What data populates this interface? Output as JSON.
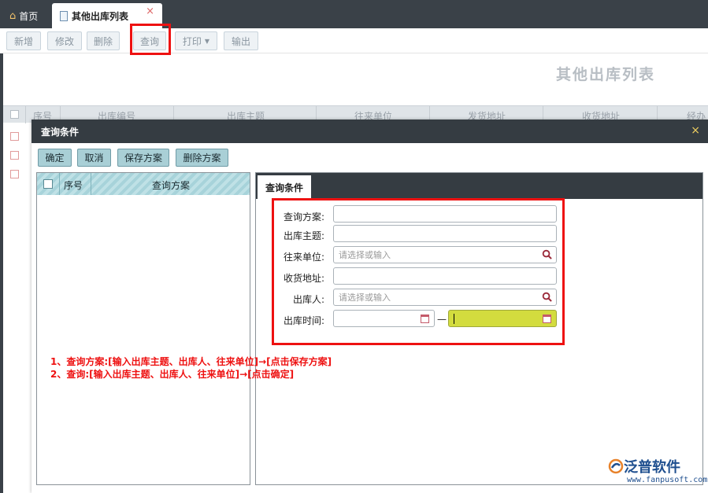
{
  "tabs": {
    "home_label": "首页",
    "active_label": "其他出库列表",
    "close_glyph": "×"
  },
  "toolbar": {
    "add": "新增",
    "edit": "修改",
    "delete": "删除",
    "query": "查询",
    "print": "打印",
    "export": "输出"
  },
  "page_title": "其他出库列表",
  "grid": {
    "columns": [
      "序号",
      "出库编号",
      "出库主题",
      "往来单位",
      "发货地址",
      "收货地址",
      "经办"
    ]
  },
  "modal": {
    "title": "查询条件",
    "close_glyph": "×",
    "buttons": {
      "confirm": "确定",
      "cancel": "取消",
      "save_plan": "保存方案",
      "delete_plan": "删除方案"
    },
    "plan_table": {
      "col_index": "序号",
      "col_plan": "查询方案"
    },
    "condition_tab": "查询条件",
    "form": {
      "plan_label": "查询方案:",
      "subject_label": "出库主题:",
      "partner_label": "往来单位:",
      "partner_placeholder": "请选择或输入",
      "receive_address_label": "收货地址:",
      "outbound_person_label": "出库人:",
      "outbound_person_placeholder": "请选择或输入",
      "outbound_time_label": "出库时间:",
      "date_separator": "—"
    }
  },
  "notes": [
    "1、查询方案:[输入出库主题、出库人、往来单位]→[点击保存方案]",
    "2、查询:[输入出库主题、出库人、往来单位]→[点击确定]"
  ],
  "logo": {
    "name": "泛普软件",
    "url": "www.fanpusoft.com"
  },
  "colors": {
    "highlight": "#ee1111",
    "header_dark": "#353c42",
    "button_teal": "#a9cfd6",
    "date_field_active": "#d3dc3e"
  }
}
